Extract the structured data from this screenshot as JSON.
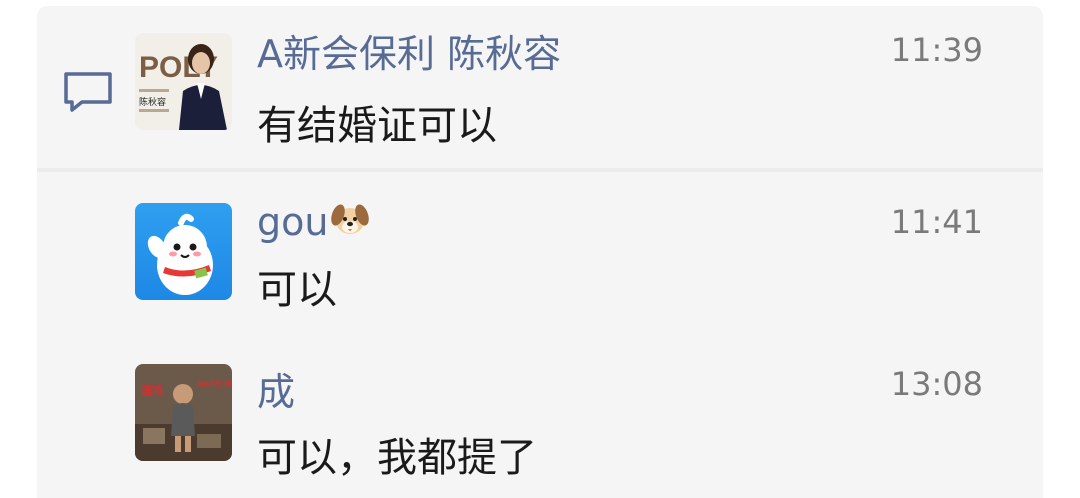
{
  "comments": [
    {
      "author": "A新会保利 陈秋容",
      "time": "11:39",
      "text": "有结婚证可以",
      "avatar": "agent-portrait",
      "avatar_text": {
        "logo": "POLY",
        "caption": "陈秋容"
      }
    },
    {
      "author": "gou",
      "author_emoji": "dog-face-icon",
      "time": "11:41",
      "text": "可以",
      "avatar": "cartoon-mascot"
    },
    {
      "author": "成",
      "time": "13:08",
      "text": "可以，我都提了",
      "avatar": "child-poster",
      "avatar_text": {
        "left": "逃难",
        "right": "逃难求生之路"
      }
    }
  ],
  "colors": {
    "name": "#576b95",
    "time": "#7a7a7a",
    "text": "#1a1a1a",
    "panel_bg": "#f5f5f5"
  },
  "icons": {
    "comment": "comment-bubble-icon"
  }
}
